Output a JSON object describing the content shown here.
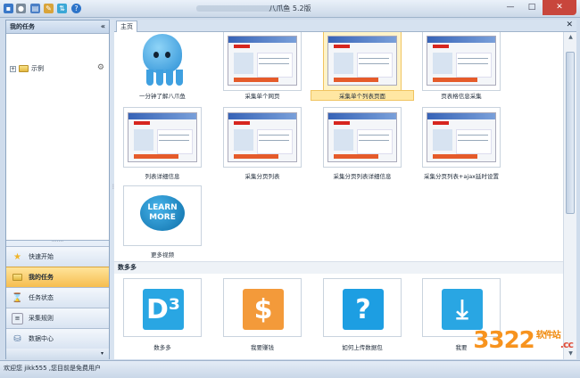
{
  "window": {
    "title": "八爪鱼 5.2版",
    "min": "—",
    "max": "□",
    "close": "✕"
  },
  "left_panel": {
    "header": "我的任务",
    "collapse": "«",
    "tree_item": "示例",
    "nav": [
      {
        "label": "快速开始",
        "icon": "star-icon"
      },
      {
        "label": "我的任务",
        "icon": "folder-icon"
      },
      {
        "label": "任务状态",
        "icon": "hourglass-icon"
      },
      {
        "label": "采集规则",
        "icon": "rules-icon"
      },
      {
        "label": "数据中心",
        "icon": "database-icon"
      }
    ],
    "footer": "▾"
  },
  "tab": {
    "label": "主页",
    "close": "✕"
  },
  "cards": [
    "一分钟了解八爪鱼",
    "采集单个网页",
    "采集单个列表页面",
    "页表格信息采集",
    "列表详细信息",
    "采集分页列表",
    "采集分页列表详细信息",
    "采集分页列表+ajax延时设置",
    "更多视频"
  ],
  "learn_more": "LEARN MORE",
  "section_title": "数多多",
  "tiles": [
    {
      "label": "数多多",
      "glyph": "D³",
      "color": "#29a6e3"
    },
    {
      "label": "我要赚钱",
      "glyph": "$",
      "color": "#f39a3a"
    },
    {
      "label": "如何上传数据包",
      "glyph": "?",
      "color": "#1d9ee2"
    },
    {
      "label": "我要",
      "glyph": "⤓",
      "color": "#29a6e3"
    }
  ],
  "status": "欢迎您  jikk555 ,您目前是免费用户",
  "watermark": {
    "num": "3322",
    "cn": "软件站",
    "cc": ".cc"
  }
}
